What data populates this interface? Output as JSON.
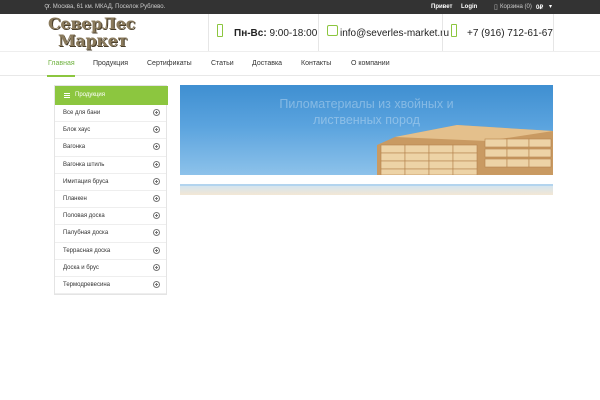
{
  "topbar": {
    "address": "г. Москва, 61 км. МКАД, Поселок Рублево.",
    "greeting": "Привет",
    "login": "Login",
    "cart": "Корзина (0)",
    "cart_total": "0₽"
  },
  "logo": {
    "line1": "СеверЛес",
    "line2": "Маркет"
  },
  "header": {
    "hours_label": "Пн-Вс:",
    "hours_value": "9:00-18:00",
    "email": "info@severles-market.ru",
    "phone": "+7 (916) 712-61-67"
  },
  "nav": {
    "items": [
      "Главная",
      "Продукция",
      "Сертификаты",
      "Статьи",
      "Доставка",
      "Контакты",
      "О компании"
    ],
    "active": "Главная"
  },
  "sidebar": {
    "title": "Продукция",
    "items": [
      "Все для бани",
      "Блок хаус",
      "Вагонка",
      "Вагонка штиль",
      "Имитация бруса",
      "Планкен",
      "Половая доска",
      "Палубная доска",
      "Террасная доска",
      "Доска и брус",
      "Термодревесина"
    ]
  },
  "banner": {
    "line1": "Пиломатериалы из хвойных и",
    "line2": "лиственных пород"
  },
  "colors": {
    "accent": "#8cc63f",
    "topbar": "#333333"
  }
}
